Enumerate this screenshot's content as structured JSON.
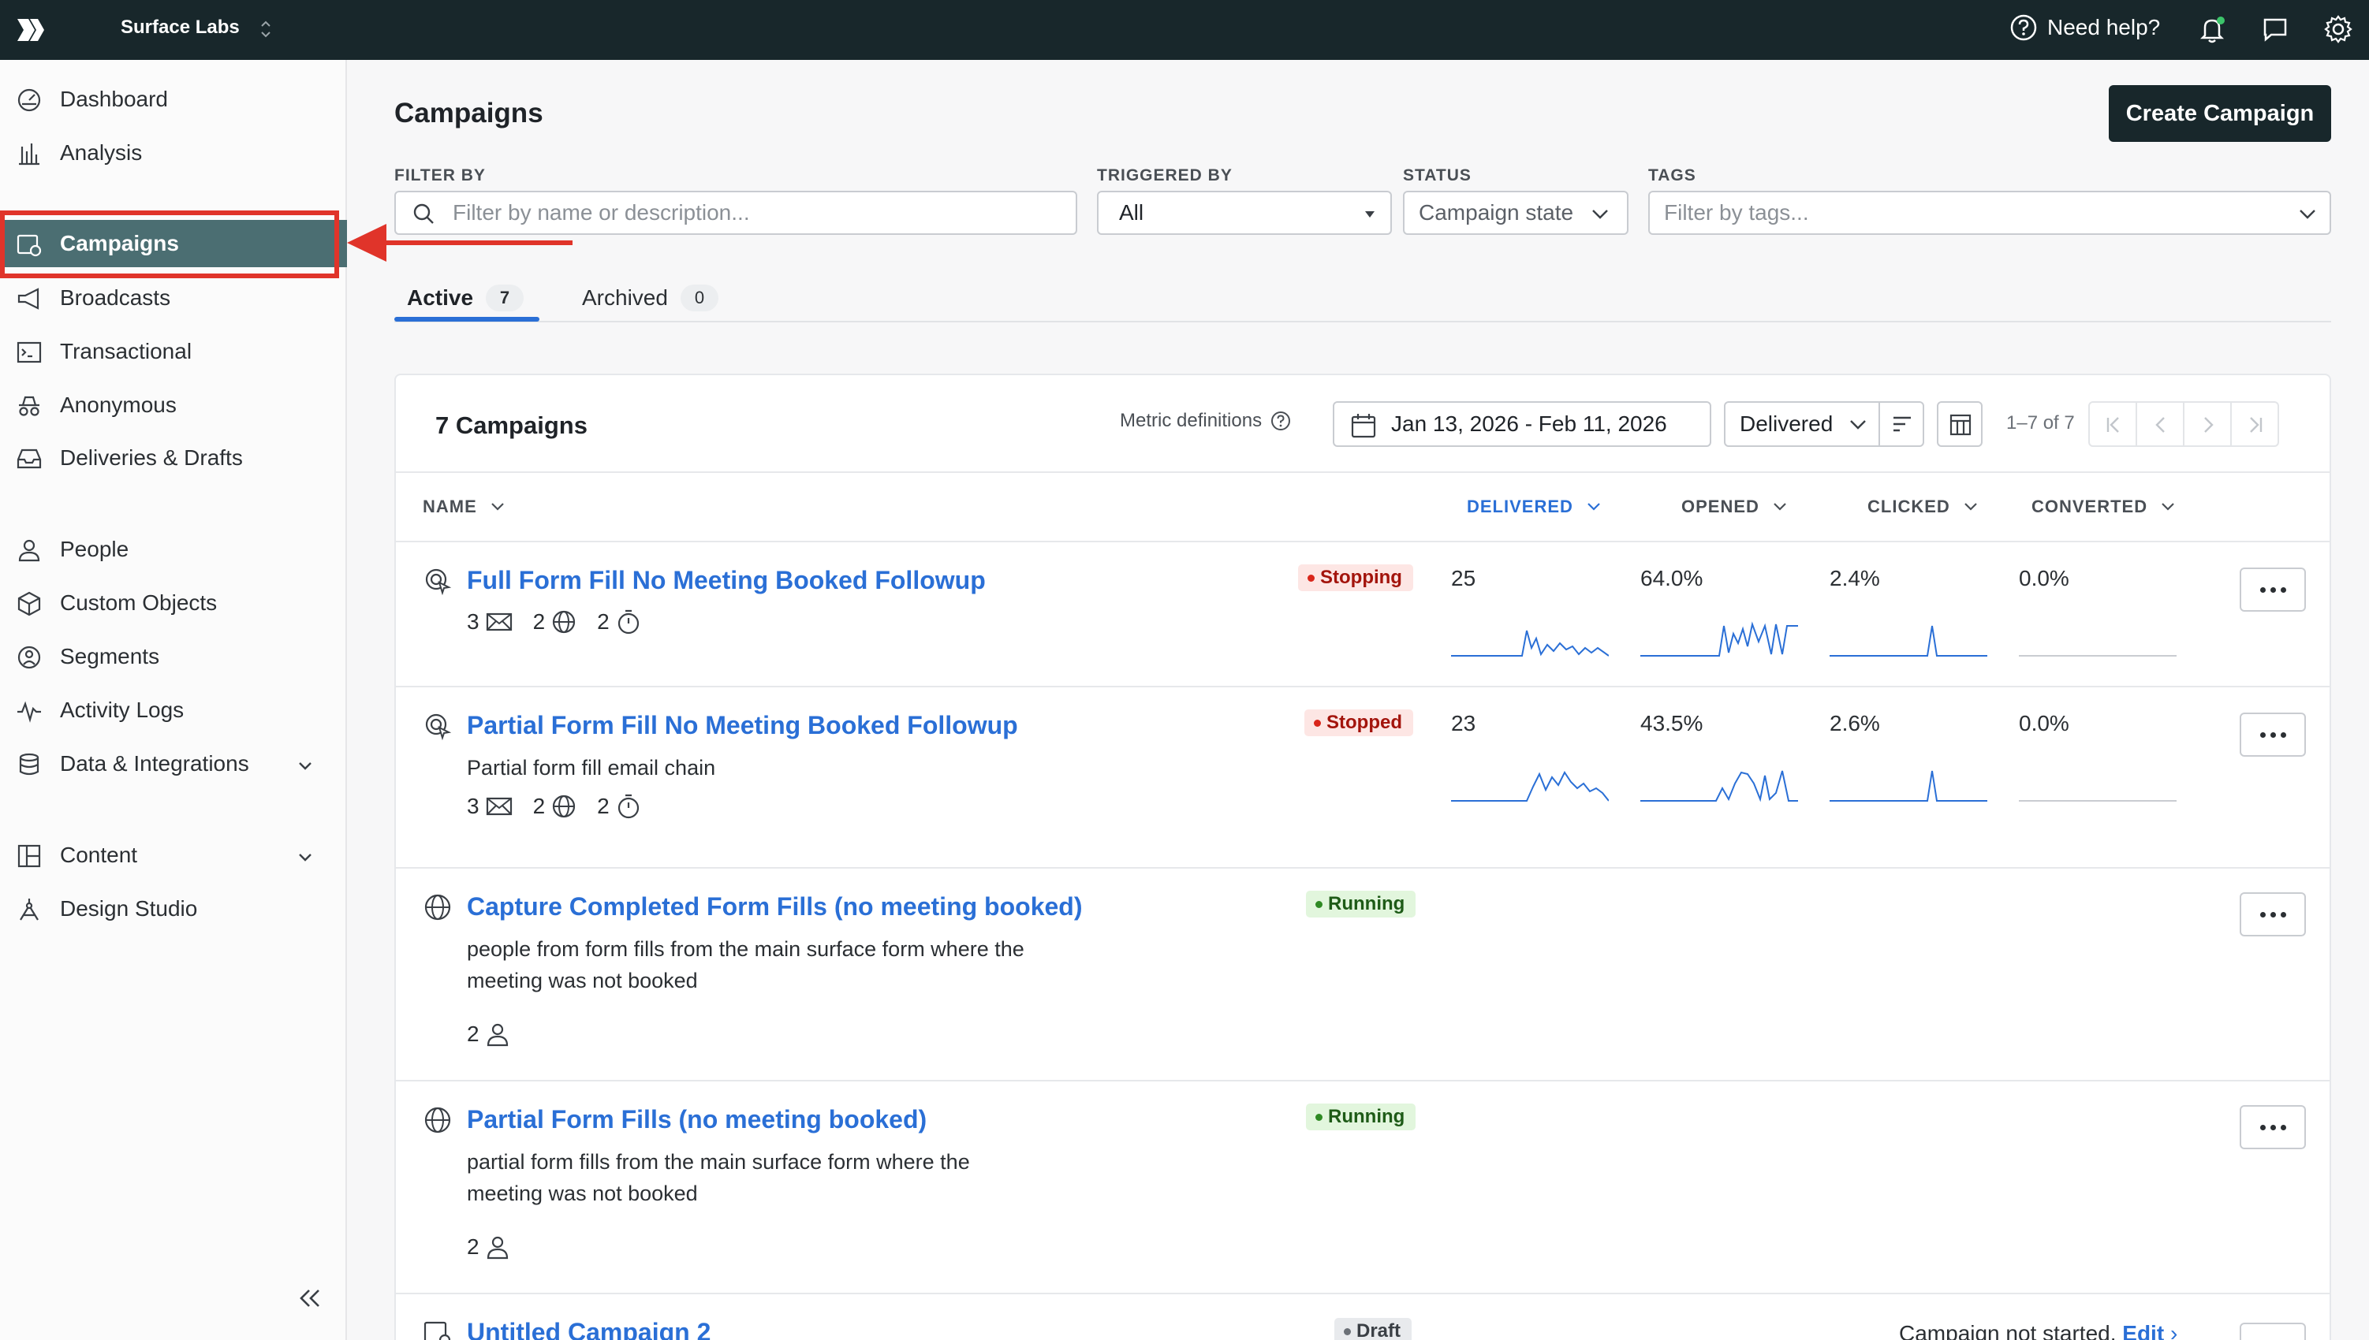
{
  "topbar": {
    "workspace": "Surface Labs",
    "help_label": "Need help?",
    "icons": [
      "logo-icon",
      "help-icon",
      "bell-icon",
      "chat-icon",
      "settings-icon"
    ]
  },
  "sidebar": {
    "items": [
      {
        "label": "Dashboard",
        "icon": "dashboard-icon"
      },
      {
        "label": "Analysis",
        "icon": "bar-chart-icon"
      },
      {
        "label": "Campaigns",
        "icon": "campaign-icon",
        "active": true
      },
      {
        "label": "Broadcasts",
        "icon": "megaphone-icon"
      },
      {
        "label": "Transactional",
        "icon": "terminal-icon"
      },
      {
        "label": "Anonymous",
        "icon": "incognito-icon"
      },
      {
        "label": "Deliveries & Drafts",
        "icon": "inbox-icon"
      },
      {
        "label": "People",
        "icon": "person-icon"
      },
      {
        "label": "Custom Objects",
        "icon": "cube-icon"
      },
      {
        "label": "Segments",
        "icon": "segment-icon"
      },
      {
        "label": "Activity Logs",
        "icon": "activity-icon"
      },
      {
        "label": "Data & Integrations",
        "icon": "database-icon"
      },
      {
        "label": "Content",
        "icon": "layout-icon"
      },
      {
        "label": "Design Studio",
        "icon": "pen-tool-icon"
      }
    ]
  },
  "page": {
    "title": "Campaigns",
    "create_button": "Create Campaign"
  },
  "filters": {
    "filter_by_label": "FILTER BY",
    "filter_by_placeholder": "Filter by name or description...",
    "triggered_by_label": "TRIGGERED BY",
    "triggered_by_value": "All",
    "status_label": "STATUS",
    "status_placeholder": "Campaign state",
    "tags_label": "TAGS",
    "tags_placeholder": "Filter by tags..."
  },
  "tabs": [
    {
      "label": "Active",
      "count": "7",
      "active": true
    },
    {
      "label": "Archived",
      "count": "0"
    }
  ],
  "card": {
    "title": "7 Campaigns",
    "metric_definitions": "Metric definitions",
    "date_range": "Jan 13, 2026 - Feb 11, 2026",
    "metric_select": "Delivered",
    "pager": "1–7 of 7",
    "columns": [
      "NAME",
      "DELIVERED",
      "OPENED",
      "CLICKED",
      "CONVERTED"
    ]
  },
  "campaigns": [
    {
      "name": "Full Form Fill No Meeting Booked Followup",
      "status": "Stopping",
      "emails": "3",
      "webhooks": "2",
      "delays": "2",
      "delivered": "25",
      "opened": "64.0%",
      "clicked": "2.4%",
      "converted": "0.0%"
    },
    {
      "name": "Partial Form Fill No Meeting Booked Followup",
      "status": "Stopped",
      "description": "Partial form fill email chain",
      "emails": "3",
      "webhooks": "2",
      "delays": "2",
      "delivered": "23",
      "opened": "43.5%",
      "clicked": "2.6%",
      "converted": "0.0%"
    },
    {
      "name": "Capture Completed Form Fills (no meeting booked)",
      "status": "Running",
      "description": "people from form fills from the main surface form where the meeting was not booked",
      "people": "2"
    },
    {
      "name": "Partial Form Fills (no meeting booked)",
      "status": "Running",
      "description": "partial form fills from the main surface form where the meeting was not booked",
      "people": "2"
    },
    {
      "name": "Untitled Campaign 2",
      "status": "Draft",
      "not_started_text": "Campaign not started.",
      "edit_link": "Edit"
    }
  ],
  "colors": {
    "topbar": "#18272b",
    "accent_blue": "#2a6fd6",
    "active_nav": "#4b6e72",
    "highlight_red": "#e0342a"
  }
}
